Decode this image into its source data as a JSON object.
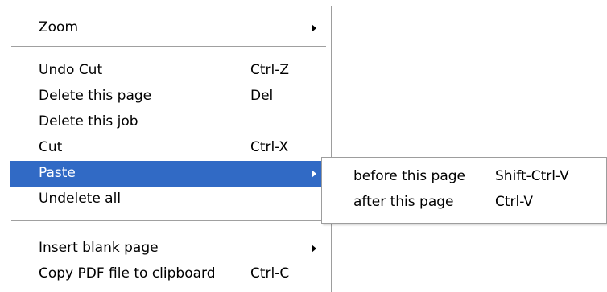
{
  "main_menu": {
    "zoom": {
      "label": "Zoom",
      "has_submenu": true
    },
    "undo_cut": {
      "label": "Undo Cut",
      "shortcut": "Ctrl-Z"
    },
    "delete_page": {
      "label": "Delete this page",
      "shortcut": "Del"
    },
    "delete_job": {
      "label": "Delete this job"
    },
    "cut": {
      "label": "Cut",
      "shortcut": "Ctrl-X"
    },
    "paste": {
      "label": "Paste",
      "has_submenu": true,
      "highlighted": true
    },
    "undelete_all": {
      "label": "Undelete all"
    },
    "insert_blank_page": {
      "label": "Insert blank page",
      "has_submenu": true
    },
    "copy_pdf": {
      "label": "Copy PDF file to clipboard",
      "shortcut": "Ctrl-C"
    }
  },
  "paste_submenu": {
    "before_page": {
      "label": "before this page",
      "shortcut": "Shift-Ctrl-V"
    },
    "after_page": {
      "label": "after this page",
      "shortcut": "Ctrl-V"
    }
  },
  "colors": {
    "highlight": "#316ac5",
    "highlight_text": "#ffffff",
    "menu_background": "#ffffff",
    "border": "#9d9d9d"
  },
  "icons": [
    "submenu-arrow-icon"
  ]
}
